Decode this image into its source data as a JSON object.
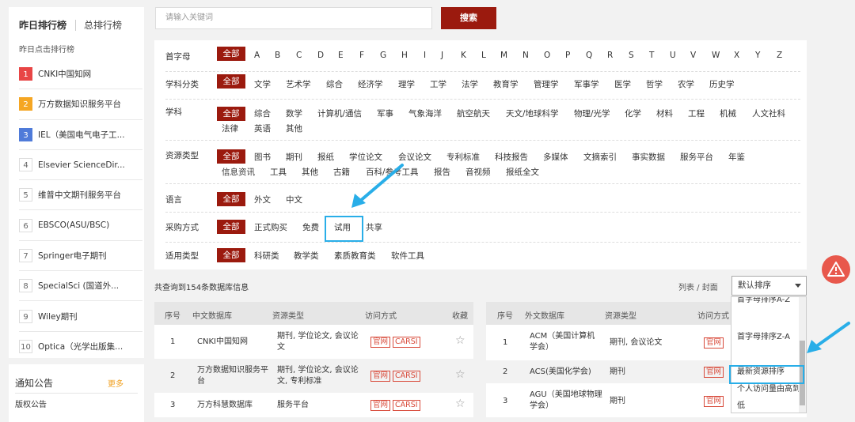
{
  "sidebar": {
    "tab_yesterday": "昨日排行榜",
    "tab_total": "总排行榜",
    "caption": "昨日点击排行榜",
    "ranks": [
      {
        "num": "1",
        "name": "CNKI中国知网"
      },
      {
        "num": "2",
        "name": "万方数据知识服务平台"
      },
      {
        "num": "3",
        "name": "IEL（美国电气电子工..."
      },
      {
        "num": "4",
        "name": "Elsevier ScienceDir..."
      },
      {
        "num": "5",
        "name": "维普中文期刊服务平台"
      },
      {
        "num": "6",
        "name": "EBSCO(ASU/BSC)"
      },
      {
        "num": "7",
        "name": "Springer电子期刊"
      },
      {
        "num": "8",
        "name": "SpecialSci (国道外..."
      },
      {
        "num": "9",
        "name": "Wiley期刊"
      },
      {
        "num": "10",
        "name": "Optica（光学出版集..."
      }
    ]
  },
  "notice": {
    "title": "通知公告",
    "more": "更多",
    "item": "版权公告"
  },
  "search": {
    "placeholder": "请输入关键词",
    "button": "搜索"
  },
  "filters": {
    "all": "全部",
    "initial": {
      "label": "首字母",
      "options": [
        "A",
        "B",
        "C",
        "D",
        "E",
        "F",
        "G",
        "H",
        "I",
        "J",
        "K",
        "L",
        "M",
        "N",
        "O",
        "P",
        "Q",
        "R",
        "S",
        "T",
        "U",
        "V",
        "W",
        "X",
        "Y",
        "Z"
      ]
    },
    "category": {
      "label": "学科分类",
      "options": [
        "文学",
        "艺术学",
        "综合",
        "经济学",
        "理学",
        "工学",
        "法学",
        "教育学",
        "管理学",
        "军事学",
        "医学",
        "哲学",
        "农学",
        "历史学"
      ]
    },
    "subject": {
      "label": "学科",
      "options_row1": [
        "综合",
        "数学",
        "计算机/通信",
        "军事",
        "气象海洋",
        "航空航天",
        "天文/地球科学",
        "物理/光学",
        "化学",
        "材料",
        "工程",
        "机械",
        "人文社科"
      ],
      "options_row2": [
        "法律",
        "英语",
        "其他"
      ]
    },
    "resource_type": {
      "label": "资源类型",
      "options_row1": [
        "图书",
        "期刊",
        "报纸",
        "学位论文",
        "会议论文",
        "专利标准",
        "科技报告",
        "多媒体",
        "文摘索引",
        "事实数据",
        "服务平台",
        "年鉴"
      ],
      "options_row2": [
        "信息资讯",
        "工具",
        "其他",
        "古籍",
        "百科/参考工具",
        "报告",
        "音视频",
        "报纸全文"
      ]
    },
    "language": {
      "label": "语言",
      "options": [
        "外文",
        "中文"
      ]
    },
    "purchase": {
      "label": "采购方式",
      "options": [
        "正式购买",
        "免费",
        "试用",
        "共享"
      ]
    },
    "usage": {
      "label": "适用类型",
      "options": [
        "科研类",
        "教学类",
        "素质教育类",
        "软件工具"
      ]
    }
  },
  "results": {
    "count_text": "共查询到154条数据库信息",
    "view_toggle": "列表 / 封面",
    "sort_selected": "默认排序",
    "sort_options": [
      "首字母排序A-Z",
      "首字母排序Z-A",
      "最新资源排序",
      "个人访问量由高到低"
    ]
  },
  "table_cn": {
    "headers": [
      "序号",
      "中文数据库",
      "资源类型",
      "访问方式",
      "收藏"
    ],
    "rows": [
      {
        "no": "1",
        "name": "CNKI中国知网",
        "type": "期刊, 学位论文, 会议论文",
        "access": [
          "官网",
          "CARSI"
        ]
      },
      {
        "no": "2",
        "name": "万方数据知识服务平台",
        "type": "期刊, 学位论文, 会议论文, 专利标准",
        "access": [
          "官网",
          "CARSI"
        ]
      },
      {
        "no": "3",
        "name": "万方科慧数据库",
        "type": "服务平台",
        "access": [
          "官网",
          "CARSI"
        ]
      }
    ]
  },
  "table_en": {
    "headers": [
      "序号",
      "外文数据库",
      "资源类型",
      "访问方式"
    ],
    "rows": [
      {
        "no": "1",
        "name": "ACM（美国计算机学会）",
        "type": "期刊, 会议论文",
        "access": [
          "官网"
        ]
      },
      {
        "no": "2",
        "name": "ACS(美国化学会)",
        "type": "期刊",
        "access": [
          "官网"
        ]
      },
      {
        "no": "3",
        "name": "AGU（美国地球物理学会）",
        "type": "期刊",
        "access": [
          "官网"
        ]
      }
    ]
  },
  "colors": {
    "brand": "#9b1a0e",
    "highlight": "#29aee8",
    "alert": "#e8584c"
  }
}
